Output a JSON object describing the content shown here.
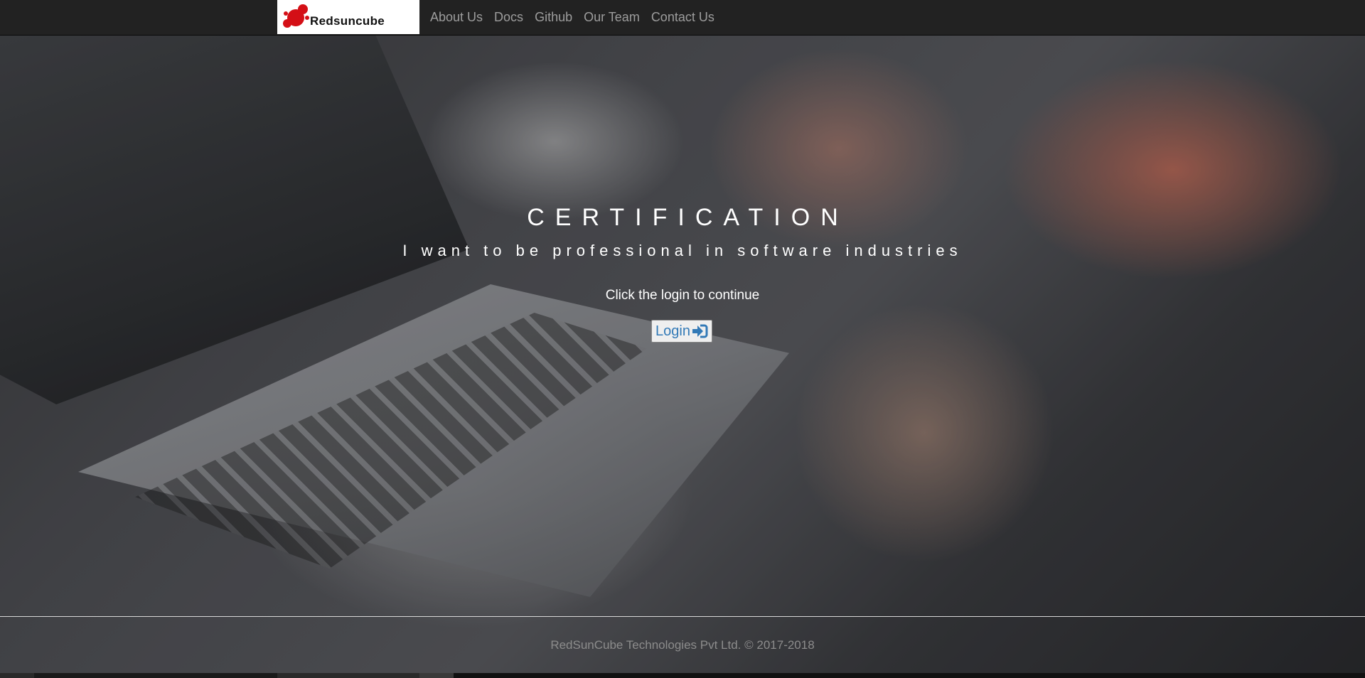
{
  "brand": {
    "name": "Redsuncube",
    "logo_icon": "red-blob-logo",
    "colors": {
      "mark": "#d40f16",
      "text": "#111111"
    }
  },
  "nav": {
    "items": [
      {
        "label": "About Us"
      },
      {
        "label": "Docs"
      },
      {
        "label": "Github"
      },
      {
        "label": "Our Team"
      },
      {
        "label": "Contact Us"
      }
    ],
    "background": "#222222",
    "link_color": "#9d9d9d"
  },
  "hero": {
    "title": "CERTIFICATION",
    "subtitle": "I want to be professional in software industries",
    "prompt": "Click the login to continue",
    "login_label": "Login",
    "login_icon": "sign-in-icon",
    "login_color": "#337ab7"
  },
  "footer": {
    "text": "RedSunCube Technologies Pvt Ltd. © 2017-2018"
  }
}
